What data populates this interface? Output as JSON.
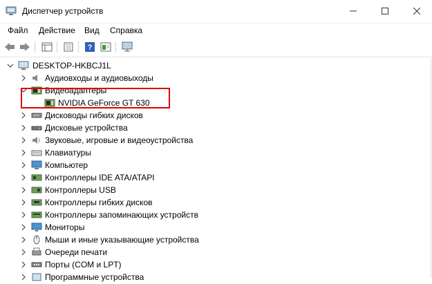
{
  "window": {
    "title": "Диспетчер устройств",
    "controls": {
      "minimize": "—",
      "maximize": "☐",
      "close": "✕"
    }
  },
  "menu": {
    "items": [
      "Файл",
      "Действие",
      "Вид",
      "Справка"
    ]
  },
  "toolbar": {
    "icons": [
      "back-arrow-icon",
      "forward-arrow-icon",
      "properties-pane-icon",
      "device-list-icon",
      "help-icon",
      "show-hide-console-tree-icon",
      "monitor-scan-icon"
    ]
  },
  "tree": {
    "root": "DESKTOP-HKBCJ1L",
    "items": [
      {
        "label": "Аудиовходы и аудиовыходы",
        "icon": "speaker-icon",
        "expanded": false
      },
      {
        "label": "Видеоадаптеры",
        "icon": "display-adapter-icon",
        "expanded": true
      },
      {
        "label": "NVIDIA GeForce GT 630",
        "icon": "display-adapter-icon",
        "child": true
      },
      {
        "label": "Дисководы гибких дисков",
        "icon": "floppy-drive-icon",
        "expanded": false
      },
      {
        "label": "Дисковые устройства",
        "icon": "disk-drive-icon",
        "expanded": false
      },
      {
        "label": "Звуковые, игровые и видеоустройства",
        "icon": "sound-icon",
        "expanded": false
      },
      {
        "label": "Клавиатуры",
        "icon": "keyboard-icon",
        "expanded": false
      },
      {
        "label": "Компьютер",
        "icon": "computer-icon",
        "expanded": false
      },
      {
        "label": "Контроллеры IDE ATA/ATAPI",
        "icon": "ide-controller-icon",
        "expanded": false
      },
      {
        "label": "Контроллеры USB",
        "icon": "usb-icon",
        "expanded": false
      },
      {
        "label": "Контроллеры гибких дисков",
        "icon": "floppy-controller-icon",
        "expanded": false
      },
      {
        "label": "Контроллеры запоминающих устройств",
        "icon": "storage-controller-icon",
        "expanded": false
      },
      {
        "label": "Мониторы",
        "icon": "monitor-icon",
        "expanded": false
      },
      {
        "label": "Мыши и иные указывающие устройства",
        "icon": "mouse-icon",
        "expanded": false
      },
      {
        "label": "Очереди печати",
        "icon": "printer-icon",
        "expanded": false
      },
      {
        "label": "Порты (COM и LPT)",
        "icon": "port-icon",
        "expanded": false
      },
      {
        "label": "Программные устройства",
        "icon": "software-device-icon",
        "expanded": false
      }
    ]
  },
  "colors": {
    "highlight_box": "#e00000",
    "accent": "#3c7fb1"
  }
}
